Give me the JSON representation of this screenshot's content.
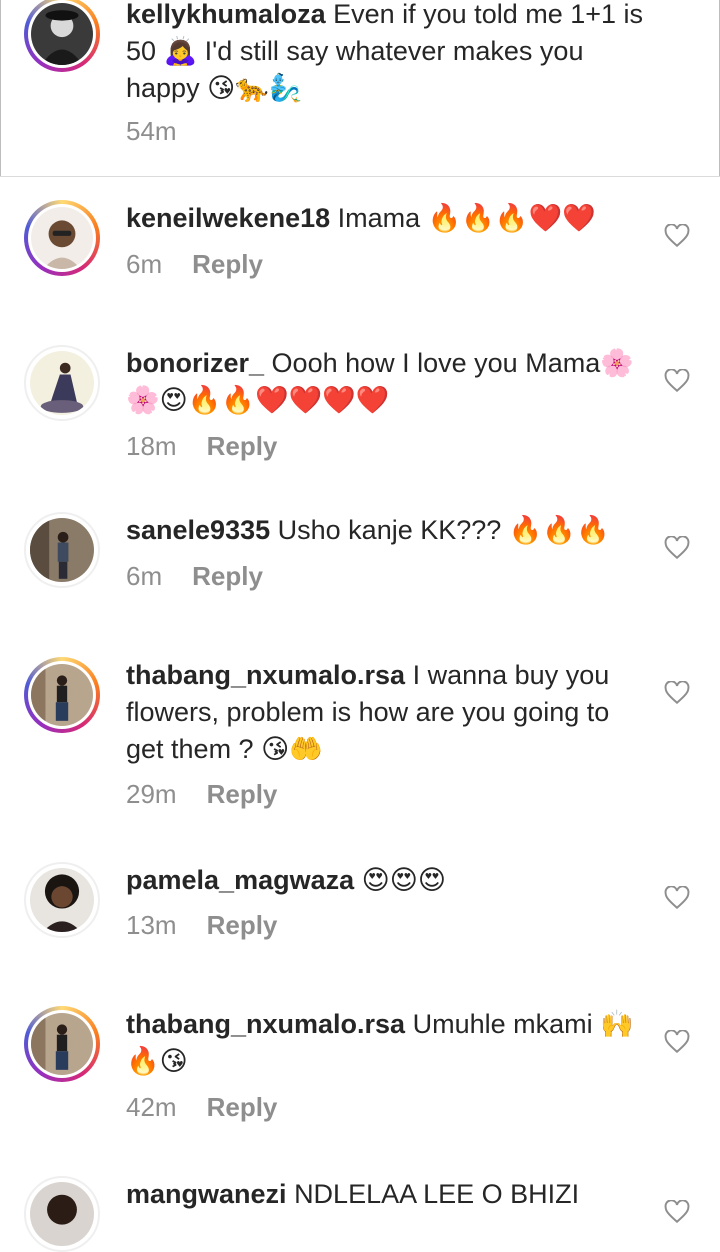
{
  "comments": [
    {
      "username": "kellykhumaloza",
      "text": "Even if you told me 1+1 is 50 🙇‍♀️ I'd still say whatever makes you happy 😘🐆🧞‍♂️",
      "time": "54m",
      "reply_label": ""
    },
    {
      "username": "keneilwekene18",
      "text": "Imama 🔥🔥🔥❤️❤️",
      "time": "6m",
      "reply_label": "Reply"
    },
    {
      "username": "bonorizer_",
      "text": "Oooh how I love you Mama🌸 🌸😍🔥🔥❤️❤️❤️❤️",
      "time": "18m",
      "reply_label": "Reply"
    },
    {
      "username": "sanele9335",
      "text": "Usho kanje  KK??? 🔥🔥🔥",
      "time": "6m",
      "reply_label": "Reply"
    },
    {
      "username": "thabang_nxumalo.rsa",
      "text": "I wanna buy you flowers, problem is how are you going to get them ? 😘🤲",
      "time": "29m",
      "reply_label": "Reply"
    },
    {
      "username": "pamela_magwaza",
      "text": "😍😍😍",
      "time": "13m",
      "reply_label": "Reply"
    },
    {
      "username": "thabang_nxumalo.rsa",
      "text": "Umuhle mkami 🙌🔥😘",
      "time": "42m",
      "reply_label": "Reply"
    },
    {
      "username": "mangwanezi",
      "text": "NDLELAA LEE O BHIZI",
      "time": "",
      "reply_label": ""
    }
  ],
  "icons": {
    "like": "heart-outline-icon"
  },
  "colors": {
    "text": "#262626",
    "meta": "#8e8e8e",
    "divider": "#dbdbdb"
  }
}
